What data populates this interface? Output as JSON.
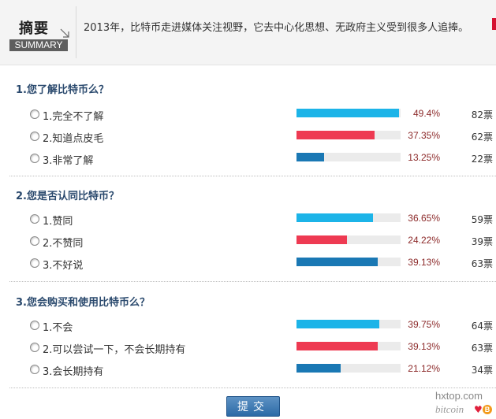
{
  "summary": {
    "title": "摘要",
    "label": "SUMMARY",
    "text": "2013年，比特币走进媒体关注视野，它去中心化思想、无政府主义受到很多人追捧。"
  },
  "colors": {
    "cyan": "#1cb4e8",
    "red": "#ee3a52",
    "blue": "#1a78b4"
  },
  "questions": [
    {
      "title": "1.您了解比特币么？",
      "options": [
        {
          "label": "1.完全不了解",
          "percent": "49.4%",
          "votes": "82票",
          "value": 0.494,
          "color": "cyan"
        },
        {
          "label": "2.知道点皮毛",
          "percent": "37.35%",
          "votes": "62票",
          "value": 0.3735,
          "color": "red"
        },
        {
          "label": "3.非常了解",
          "percent": "13.25%",
          "votes": "22票",
          "value": 0.1325,
          "color": "blue"
        }
      ]
    },
    {
      "title": "2.您是否认同比特币？",
      "options": [
        {
          "label": "1.赞同",
          "percent": "36.65%",
          "votes": "59票",
          "value": 0.3665,
          "color": "cyan"
        },
        {
          "label": "2.不赞同",
          "percent": "24.22%",
          "votes": "39票",
          "value": 0.2422,
          "color": "red"
        },
        {
          "label": "3.不好说",
          "percent": "39.13%",
          "votes": "63票",
          "value": 0.3913,
          "color": "blue"
        }
      ]
    },
    {
      "title": "3.您会购买和使用比特币么？",
      "options": [
        {
          "label": "1.不会",
          "percent": "39.75%",
          "votes": "64票",
          "value": 0.3975,
          "color": "cyan"
        },
        {
          "label": "2.可以尝试一下，不会长期持有",
          "percent": "39.13%",
          "votes": "63票",
          "value": 0.3913,
          "color": "red"
        },
        {
          "label": "3.会长期持有",
          "percent": "21.12%",
          "votes": "34票",
          "value": 0.2112,
          "color": "blue"
        }
      ]
    }
  ],
  "submit_label": "提交",
  "watermark": {
    "site": "hxtop.com",
    "brand": "bitcoin",
    "coin_symbol": "B"
  }
}
